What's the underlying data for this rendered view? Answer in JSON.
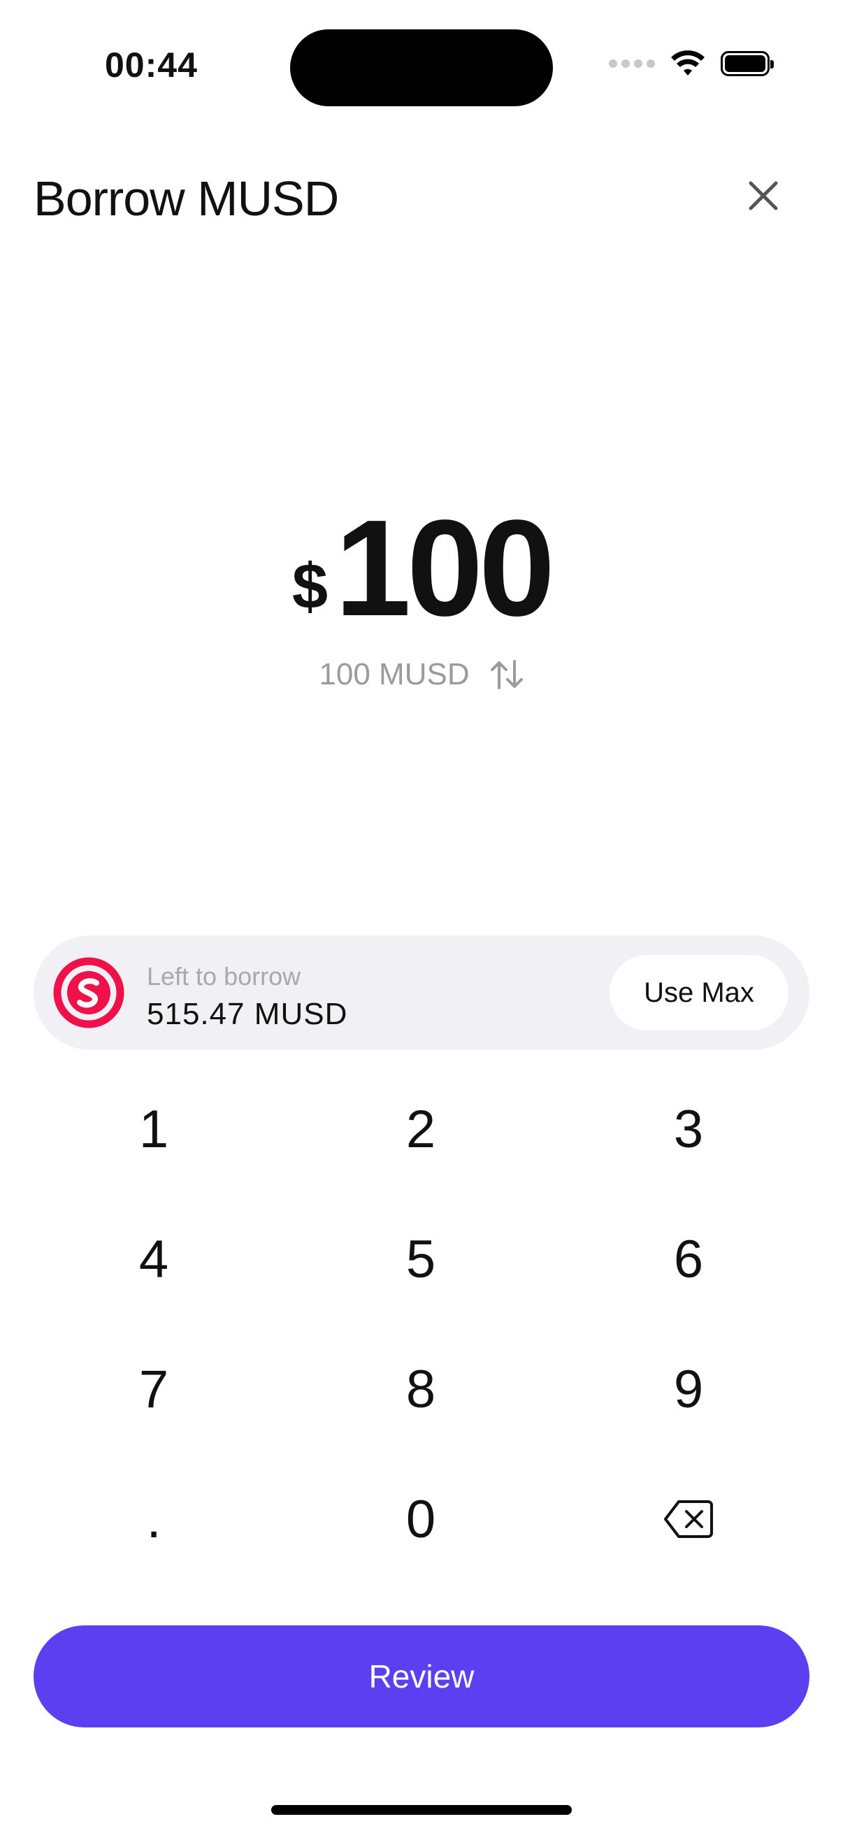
{
  "status_bar": {
    "time": "00:44"
  },
  "header": {
    "title": "Borrow MUSD",
    "close_icon": "close-icon"
  },
  "amount": {
    "currency_symbol": "$",
    "value": "100",
    "converted": "100 MUSD",
    "swap_icon": "swap-vertical-icon"
  },
  "borrow_card": {
    "token_icon": "musd-logo-icon",
    "label": "Left to borrow",
    "value": "515.47 MUSD",
    "use_max_label": "Use Max"
  },
  "keypad": {
    "keys": [
      "1",
      "2",
      "3",
      "4",
      "5",
      "6",
      "7",
      "8",
      "9",
      ".",
      "0"
    ],
    "backspace_icon": "backspace-icon"
  },
  "review_label": "Review",
  "colors": {
    "accent": "#5b3ff0",
    "brand_token": "#f0114a",
    "card_bg": "#f0f0f5",
    "muted_text": "#9a9aa0"
  }
}
